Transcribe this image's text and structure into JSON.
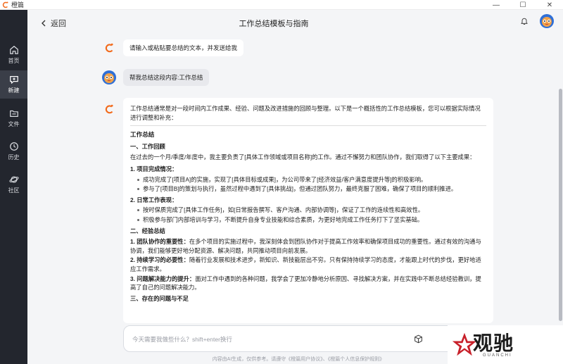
{
  "app": {
    "name": "橙篇",
    "window_controls": [
      "—",
      "☐",
      "✕"
    ]
  },
  "sidebar": {
    "items": [
      {
        "label": "首页",
        "icon": "home-icon"
      },
      {
        "label": "新建",
        "icon": "new-chat-icon",
        "active": true
      },
      {
        "label": "文件",
        "icon": "folder-icon"
      },
      {
        "label": "历史",
        "icon": "clock-icon"
      },
      {
        "label": "社区",
        "icon": "planet-icon"
      }
    ]
  },
  "header": {
    "back_label": "返回",
    "title": "工作总结模板与指南"
  },
  "conversation": {
    "ai_prompt": "请输入或粘贴要总结的文本，并发送给我",
    "user_message": "帮我总结这段内容:工作总结",
    "answer": {
      "intro": "工作总结通常是对一段时间内工作成果、经验、问题及改进措施的回顾与整理。以下是一个概括性的工作总结模板，您可以根据实际情况进行调整和补充：",
      "heading": "工作总结",
      "section1_title": "一、工作回顾",
      "section1_para": "在过去的一个月/季度/年度中，我主要负责了[具体工作领域或项目名称]的工作。通过不懈努力和团队协作，我们取得了以下主要成果：",
      "item1_title": "1. 项目完成情况：",
      "item1_bullets": [
        "成功完成了[项目A]的实施，实现了[具体目标或成果]，为公司带来了[经济效益/客户满意度提升等]的积极影响。",
        "参与了[项目B]的策划与执行，虽然过程中遇到了[具体挑战]，但通过团队努力，最终克服了困难，确保了项目的顺利推进。"
      ],
      "item2_title": "2. 日常工作表现：",
      "item2_bullets": [
        "按时保质完成了[具体工作任务]，如[日常报告撰写、客户沟通、内部协调等]，保证了工作的连续性和高效性。",
        "积极参与部门内部培训与学习，不断提升自身专业技能和综合素质，为更好地完成工作任务打下了坚实基础。"
      ],
      "section2_title": "二、经验总结",
      "section2_items": [
        {
          "key": "1. 团队协作的重要性：",
          "text": "在多个项目的实施过程中，我深刻体会到团队协作对于提高工作效率和确保项目成功的重要性。通过有效的沟通与协调，我们能够更好地分配资源、解决问题，共同推动项目向前发展。"
        },
        {
          "key": "2. 持续学习的必要性：",
          "text": "随着行业发展和技术进步，新知识、新技能层出不穷。只有保持持续学习的态度，才能跟上时代的步伐，更好地适应工作需求。"
        },
        {
          "key": "3. 问题解决能力的提升：",
          "text": "面对工作中遇到的各种问题，我学会了更加冷静地分析原因、寻找解决方案，并在实践中不断总结经验教训，提高了自己的问题解决能力。"
        }
      ],
      "section3_title": "三、存在的问题与不足"
    }
  },
  "composer": {
    "placeholder": "今天需要我做些什么？shift+enter换行"
  },
  "footer": {
    "note": "内容由AI生成，仅供参考。请遵守《橙篇用户协议》、《橙篇个人信息保护规则》"
  },
  "watermark": {
    "text": "观驰",
    "sub": "GUANCHI"
  },
  "colors": {
    "brand_orange": "#f26a1b",
    "sidebar_bg": "#23262e"
  }
}
